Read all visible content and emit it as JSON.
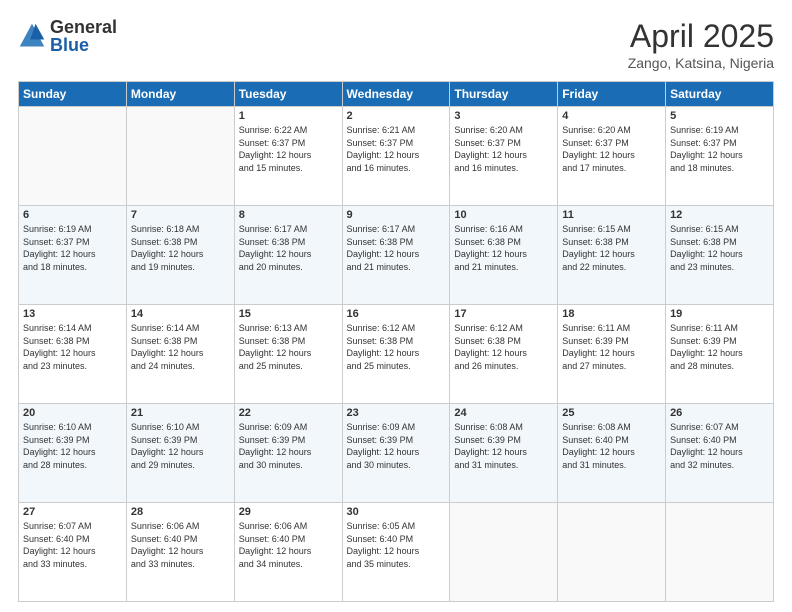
{
  "header": {
    "logo_general": "General",
    "logo_blue": "Blue",
    "title": "April 2025",
    "subtitle": "Zango, Katsina, Nigeria"
  },
  "weekdays": [
    "Sunday",
    "Monday",
    "Tuesday",
    "Wednesday",
    "Thursday",
    "Friday",
    "Saturday"
  ],
  "weeks": [
    [
      {
        "num": "",
        "sunrise": "",
        "sunset": "",
        "daylight": ""
      },
      {
        "num": "",
        "sunrise": "",
        "sunset": "",
        "daylight": ""
      },
      {
        "num": "1",
        "sunrise": "Sunrise: 6:22 AM",
        "sunset": "Sunset: 6:37 PM",
        "daylight": "Daylight: 12 hours and 15 minutes."
      },
      {
        "num": "2",
        "sunrise": "Sunrise: 6:21 AM",
        "sunset": "Sunset: 6:37 PM",
        "daylight": "Daylight: 12 hours and 16 minutes."
      },
      {
        "num": "3",
        "sunrise": "Sunrise: 6:20 AM",
        "sunset": "Sunset: 6:37 PM",
        "daylight": "Daylight: 12 hours and 16 minutes."
      },
      {
        "num": "4",
        "sunrise": "Sunrise: 6:20 AM",
        "sunset": "Sunset: 6:37 PM",
        "daylight": "Daylight: 12 hours and 17 minutes."
      },
      {
        "num": "5",
        "sunrise": "Sunrise: 6:19 AM",
        "sunset": "Sunset: 6:37 PM",
        "daylight": "Daylight: 12 hours and 18 minutes."
      }
    ],
    [
      {
        "num": "6",
        "sunrise": "Sunrise: 6:19 AM",
        "sunset": "Sunset: 6:37 PM",
        "daylight": "Daylight: 12 hours and 18 minutes."
      },
      {
        "num": "7",
        "sunrise": "Sunrise: 6:18 AM",
        "sunset": "Sunset: 6:38 PM",
        "daylight": "Daylight: 12 hours and 19 minutes."
      },
      {
        "num": "8",
        "sunrise": "Sunrise: 6:17 AM",
        "sunset": "Sunset: 6:38 PM",
        "daylight": "Daylight: 12 hours and 20 minutes."
      },
      {
        "num": "9",
        "sunrise": "Sunrise: 6:17 AM",
        "sunset": "Sunset: 6:38 PM",
        "daylight": "Daylight: 12 hours and 21 minutes."
      },
      {
        "num": "10",
        "sunrise": "Sunrise: 6:16 AM",
        "sunset": "Sunset: 6:38 PM",
        "daylight": "Daylight: 12 hours and 21 minutes."
      },
      {
        "num": "11",
        "sunrise": "Sunrise: 6:15 AM",
        "sunset": "Sunset: 6:38 PM",
        "daylight": "Daylight: 12 hours and 22 minutes."
      },
      {
        "num": "12",
        "sunrise": "Sunrise: 6:15 AM",
        "sunset": "Sunset: 6:38 PM",
        "daylight": "Daylight: 12 hours and 23 minutes."
      }
    ],
    [
      {
        "num": "13",
        "sunrise": "Sunrise: 6:14 AM",
        "sunset": "Sunset: 6:38 PM",
        "daylight": "Daylight: 12 hours and 23 minutes."
      },
      {
        "num": "14",
        "sunrise": "Sunrise: 6:14 AM",
        "sunset": "Sunset: 6:38 PM",
        "daylight": "Daylight: 12 hours and 24 minutes."
      },
      {
        "num": "15",
        "sunrise": "Sunrise: 6:13 AM",
        "sunset": "Sunset: 6:38 PM",
        "daylight": "Daylight: 12 hours and 25 minutes."
      },
      {
        "num": "16",
        "sunrise": "Sunrise: 6:12 AM",
        "sunset": "Sunset: 6:38 PM",
        "daylight": "Daylight: 12 hours and 25 minutes."
      },
      {
        "num": "17",
        "sunrise": "Sunrise: 6:12 AM",
        "sunset": "Sunset: 6:38 PM",
        "daylight": "Daylight: 12 hours and 26 minutes."
      },
      {
        "num": "18",
        "sunrise": "Sunrise: 6:11 AM",
        "sunset": "Sunset: 6:39 PM",
        "daylight": "Daylight: 12 hours and 27 minutes."
      },
      {
        "num": "19",
        "sunrise": "Sunrise: 6:11 AM",
        "sunset": "Sunset: 6:39 PM",
        "daylight": "Daylight: 12 hours and 28 minutes."
      }
    ],
    [
      {
        "num": "20",
        "sunrise": "Sunrise: 6:10 AM",
        "sunset": "Sunset: 6:39 PM",
        "daylight": "Daylight: 12 hours and 28 minutes."
      },
      {
        "num": "21",
        "sunrise": "Sunrise: 6:10 AM",
        "sunset": "Sunset: 6:39 PM",
        "daylight": "Daylight: 12 hours and 29 minutes."
      },
      {
        "num": "22",
        "sunrise": "Sunrise: 6:09 AM",
        "sunset": "Sunset: 6:39 PM",
        "daylight": "Daylight: 12 hours and 30 minutes."
      },
      {
        "num": "23",
        "sunrise": "Sunrise: 6:09 AM",
        "sunset": "Sunset: 6:39 PM",
        "daylight": "Daylight: 12 hours and 30 minutes."
      },
      {
        "num": "24",
        "sunrise": "Sunrise: 6:08 AM",
        "sunset": "Sunset: 6:39 PM",
        "daylight": "Daylight: 12 hours and 31 minutes."
      },
      {
        "num": "25",
        "sunrise": "Sunrise: 6:08 AM",
        "sunset": "Sunset: 6:40 PM",
        "daylight": "Daylight: 12 hours and 31 minutes."
      },
      {
        "num": "26",
        "sunrise": "Sunrise: 6:07 AM",
        "sunset": "Sunset: 6:40 PM",
        "daylight": "Daylight: 12 hours and 32 minutes."
      }
    ],
    [
      {
        "num": "27",
        "sunrise": "Sunrise: 6:07 AM",
        "sunset": "Sunset: 6:40 PM",
        "daylight": "Daylight: 12 hours and 33 minutes."
      },
      {
        "num": "28",
        "sunrise": "Sunrise: 6:06 AM",
        "sunset": "Sunset: 6:40 PM",
        "daylight": "Daylight: 12 hours and 33 minutes."
      },
      {
        "num": "29",
        "sunrise": "Sunrise: 6:06 AM",
        "sunset": "Sunset: 6:40 PM",
        "daylight": "Daylight: 12 hours and 34 minutes."
      },
      {
        "num": "30",
        "sunrise": "Sunrise: 6:05 AM",
        "sunset": "Sunset: 6:40 PM",
        "daylight": "Daylight: 12 hours and 35 minutes."
      },
      {
        "num": "",
        "sunrise": "",
        "sunset": "",
        "daylight": ""
      },
      {
        "num": "",
        "sunrise": "",
        "sunset": "",
        "daylight": ""
      },
      {
        "num": "",
        "sunrise": "",
        "sunset": "",
        "daylight": ""
      }
    ]
  ]
}
